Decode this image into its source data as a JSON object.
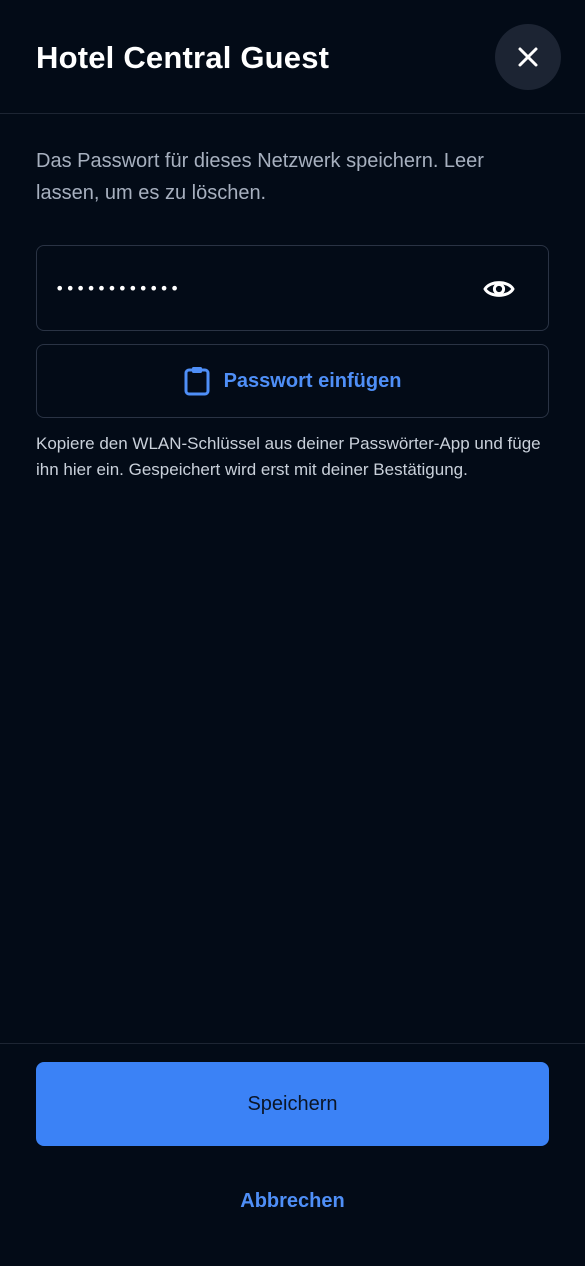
{
  "dialog": {
    "title": "Hotel Central Guest",
    "close_icon": "close-icon",
    "description": "Das Passwort für dieses Netzwerk speichern. Leer lassen, um es zu löschen."
  },
  "password": {
    "value": "••••••••••••",
    "reveal_icon": "eye-icon"
  },
  "paste": {
    "icon": "clipboard-icon",
    "label": "Passwort einfügen"
  },
  "hint": "Kopiere den WLAN-Schlüssel aus deiner Passwörter-App und füge ihn hier ein. Gespeichert wird erst mit deiner Bestätigung.",
  "actions": {
    "save_label": "Speichern",
    "cancel_label": "Abbrechen"
  },
  "colors": {
    "background": "#030b17",
    "accent": "#3b82f6",
    "link": "#4f8ff7",
    "border": "#2a3344"
  }
}
